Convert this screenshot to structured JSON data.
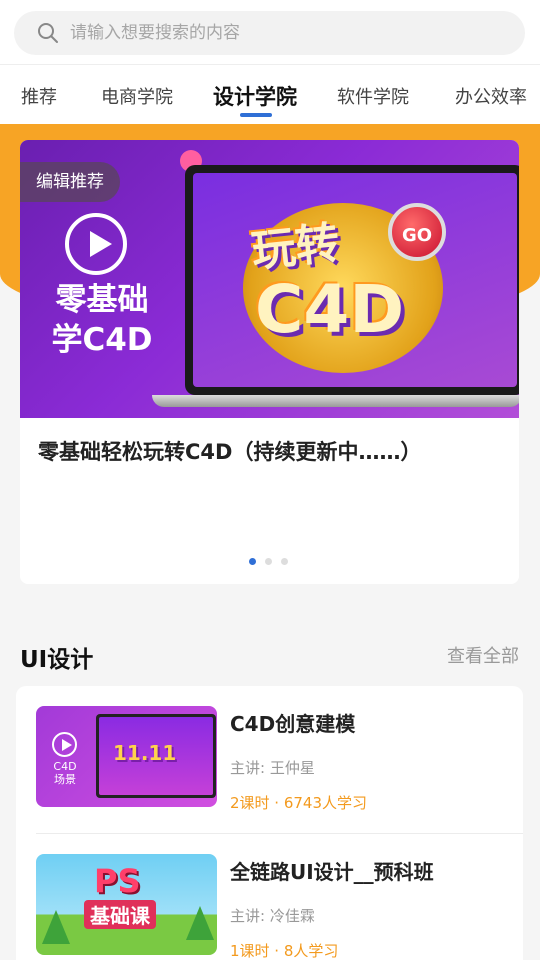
{
  "search": {
    "placeholder": "请输入想要搜索的内容"
  },
  "tabs": [
    {
      "label": "推荐"
    },
    {
      "label": "电商学院"
    },
    {
      "label": "设计学院",
      "active": true
    },
    {
      "label": "软件学院"
    },
    {
      "label": "办公效率"
    }
  ],
  "featured": {
    "tag": "编辑推荐",
    "side_text": "零基础学C4D",
    "emblem_line1": "玩转",
    "emblem_line2": "C4D",
    "go": "GO",
    "title": "零基础轻松玩转C4D（持续更新中……）",
    "page_count": 3,
    "active_page": 1
  },
  "section": {
    "title": "UI设计",
    "see_all": "查看全部"
  },
  "courses": [
    {
      "title": "C4D创意建模",
      "teacher": "主讲: 王仲星",
      "meta": "2课时 · 6743人学习",
      "thumb_text": "C4D场景",
      "thumb_banner": "11.11"
    },
    {
      "title": "全链路UI设计__预科班",
      "teacher": "主讲: 冷佳霖",
      "meta": "1课时 · 8人学习",
      "thumb_text": "PS",
      "thumb_banner": "基础课"
    }
  ],
  "colors": {
    "accent": "#2f6fd6",
    "orange": "#f7a425",
    "meta": "#f39a1e"
  }
}
